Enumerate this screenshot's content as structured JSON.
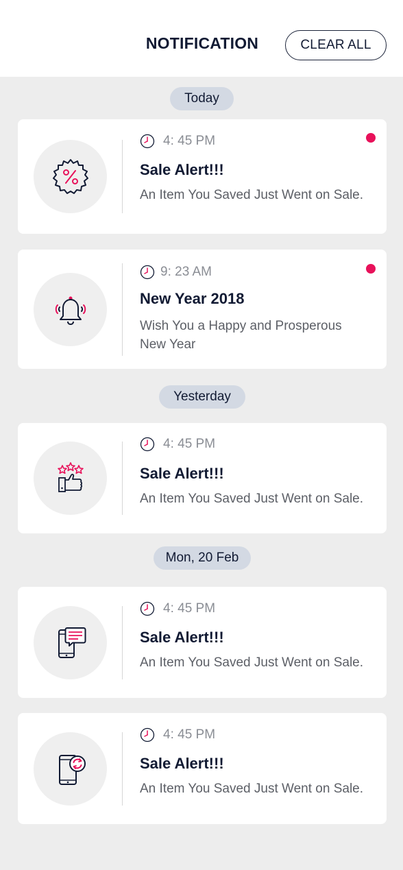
{
  "header": {
    "title": "NOTIFICATION",
    "clear_label": "CLEAR ALL"
  },
  "colors": {
    "accent": "#e8115a",
    "pill_bg": "#d3d9e3",
    "text": "#111a33"
  },
  "groups": [
    {
      "label": "Today"
    },
    {
      "label": "Yesterday"
    },
    {
      "label": "Mon, 20 Feb"
    }
  ],
  "notifications": [
    {
      "icon": "sale-badge-icon",
      "time": "4: 45 PM",
      "title": "Sale Alert!!!",
      "desc": "An Item You Saved Just Went on Sale.",
      "unread": true
    },
    {
      "icon": "bell-icon",
      "time": "9: 23 AM",
      "title": "New Year 2018",
      "desc": "Wish You a Happy and Prosperous New Year",
      "unread": true
    },
    {
      "icon": "thumbs-up-stars-icon",
      "time": "4: 45 PM",
      "title": "Sale Alert!!!",
      "desc": "An Item You Saved Just Went on Sale.",
      "unread": false
    },
    {
      "icon": "phone-message-icon",
      "time": "4: 45 PM",
      "title": "Sale Alert!!!",
      "desc": "An Item You Saved Just Went on Sale.",
      "unread": false
    },
    {
      "icon": "phone-sync-icon",
      "time": "4: 45 PM",
      "title": "Sale Alert!!!",
      "desc": "An Item You Saved Just Went on Sale.",
      "unread": false
    }
  ]
}
